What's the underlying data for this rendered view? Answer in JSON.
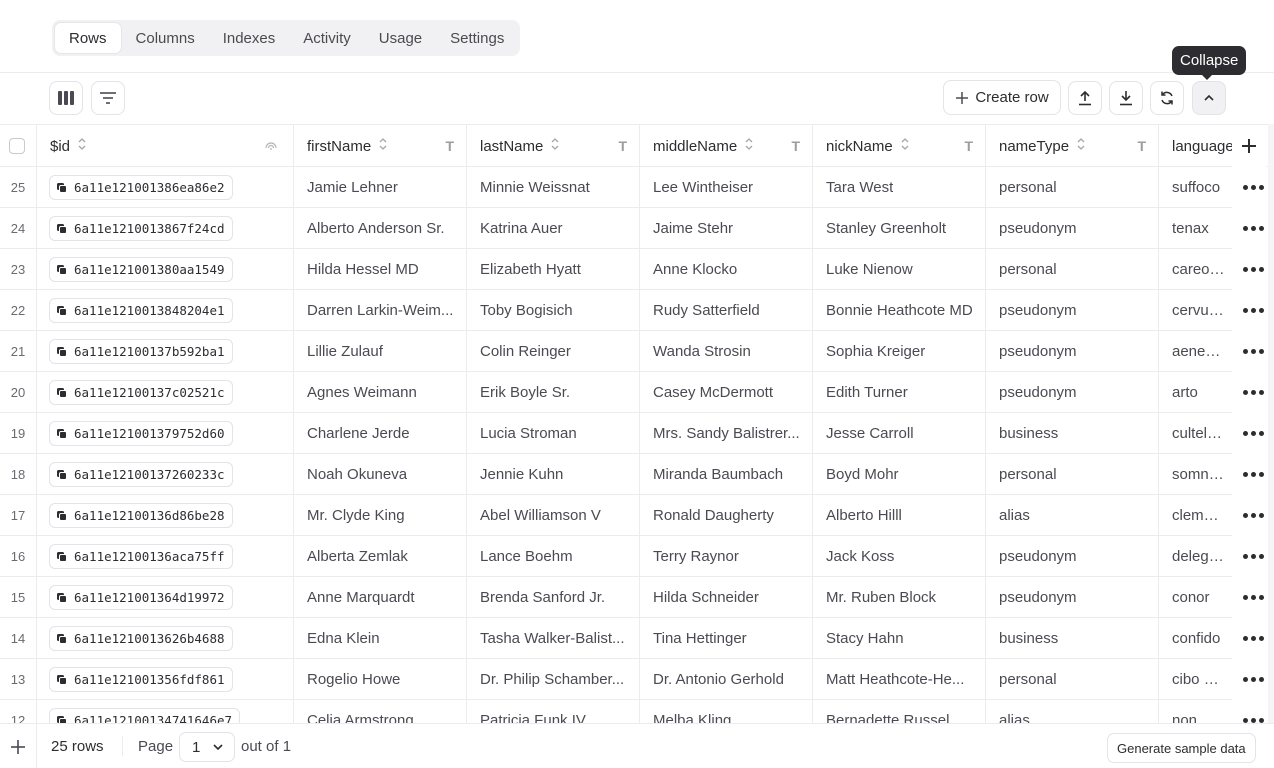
{
  "tabs": [
    {
      "label": "Rows",
      "active": true
    },
    {
      "label": "Columns"
    },
    {
      "label": "Indexes"
    },
    {
      "label": "Activity"
    },
    {
      "label": "Usage"
    },
    {
      "label": "Settings"
    }
  ],
  "tooltip": "Collapse",
  "toolbar": {
    "create_row_label": "Create row",
    "icons": [
      "columns-icon",
      "filter-icon",
      "upload-icon",
      "download-icon",
      "refresh-icon",
      "chevron-up-icon"
    ]
  },
  "columns": [
    {
      "key": "id",
      "label": "$id"
    },
    {
      "key": "firstName",
      "label": "firstName"
    },
    {
      "key": "lastName",
      "label": "lastName"
    },
    {
      "key": "middleName",
      "label": "middleName"
    },
    {
      "key": "nickName",
      "label": "nickName"
    },
    {
      "key": "nameType",
      "label": "nameType"
    },
    {
      "key": "language",
      "label": "language"
    }
  ],
  "rows": [
    {
      "num": "25",
      "id": "6a11e121001386ea86e2",
      "firstName": "Jamie Lehner",
      "lastName": "Minnie Weissnat",
      "middleName": "Lee Wintheiser",
      "nickName": "Tara West",
      "nameType": "personal",
      "language": "suffoco"
    },
    {
      "num": "24",
      "id": "6a11e1210013867f24cd",
      "firstName": "Alberto Anderson Sr.",
      "lastName": "Katrina Auer",
      "middleName": "Jaime Stehr",
      "nickName": "Stanley Greenholt",
      "nameType": "pseudonym",
      "language": "tenax"
    },
    {
      "num": "23",
      "id": "6a11e121001380aa1549",
      "firstName": "Hilda Hessel MD",
      "lastName": "Elizabeth Hyatt",
      "middleName": "Anne Klocko",
      "nickName": "Luke Nienow",
      "nameType": "personal",
      "language": "careo bo"
    },
    {
      "num": "22",
      "id": "6a11e1210013848204e1",
      "firstName": "Darren Larkin-Weim...",
      "lastName": "Toby Bogisich",
      "middleName": "Rudy Satterfield",
      "nickName": "Bonnie Heathcote MD",
      "nameType": "pseudonym",
      "language": "cervus c"
    },
    {
      "num": "21",
      "id": "6a11e12100137b592ba1",
      "firstName": "Lillie Zulauf",
      "lastName": "Colin Reinger",
      "middleName": "Wanda Strosin",
      "nickName": "Sophia Kreiger",
      "nameType": "pseudonym",
      "language": "aeneus u"
    },
    {
      "num": "20",
      "id": "6a11e12100137c02521c",
      "firstName": "Agnes Weimann",
      "lastName": "Erik Boyle Sr.",
      "middleName": "Casey McDermott",
      "nickName": "Edith Turner",
      "nameType": "pseudonym",
      "language": "arto"
    },
    {
      "num": "19",
      "id": "6a11e121001379752d60",
      "firstName": "Charlene Jerde",
      "lastName": "Lucia Stroman",
      "middleName": "Mrs. Sandy Balistrer...",
      "nickName": "Jesse Carroll",
      "nameType": "business",
      "language": "cultellus"
    },
    {
      "num": "18",
      "id": "6a11e12100137260233c",
      "firstName": "Noah Okuneva",
      "lastName": "Jennie Kuhn",
      "middleName": "Miranda Baumbach",
      "nickName": "Boyd Mohr",
      "nameType": "personal",
      "language": "somnicu"
    },
    {
      "num": "17",
      "id": "6a11e12100136d86be28",
      "firstName": "Mr. Clyde King",
      "lastName": "Abel Williamson V",
      "middleName": "Ronald Daugherty",
      "nickName": "Alberto Hilll",
      "nameType": "alias",
      "language": "clementi"
    },
    {
      "num": "16",
      "id": "6a11e12100136aca75ff",
      "firstName": "Alberta Zemlak",
      "lastName": "Lance Boehm",
      "middleName": "Terry Raynor",
      "nickName": "Jack Koss",
      "nameType": "pseudonym",
      "language": "delego c"
    },
    {
      "num": "15",
      "id": "6a11e121001364d19972",
      "firstName": "Anne Marquardt",
      "lastName": "Brenda Sanford Jr.",
      "middleName": "Hilda Schneider",
      "nickName": "Mr. Ruben Block",
      "nameType": "pseudonym",
      "language": "conor"
    },
    {
      "num": "14",
      "id": "6a11e1210013626b4688",
      "firstName": "Edna Klein",
      "lastName": "Tasha Walker-Balist...",
      "middleName": "Tina Hettinger",
      "nickName": "Stacy Hahn",
      "nameType": "business",
      "language": "confido"
    },
    {
      "num": "13",
      "id": "6a11e121001356fdf861",
      "firstName": "Rogelio Howe",
      "lastName": "Dr. Philip Schamber...",
      "middleName": "Dr. Antonio Gerhold",
      "nickName": "Matt Heathcote-He...",
      "nameType": "personal",
      "language": "cibo pau"
    },
    {
      "num": "12",
      "id": "6a11e12100134741646e7",
      "firstName": "Celia Armstrong",
      "lastName": "Patricia Funk IV",
      "middleName": "Melba Kling",
      "nickName": "Bernadette Russel",
      "nameType": "alias",
      "language": "non"
    }
  ],
  "footer": {
    "rows_label": "25 rows",
    "page_label": "Page",
    "page_value": "1",
    "out_of": "out of 1",
    "generate_label": "Generate sample data"
  }
}
